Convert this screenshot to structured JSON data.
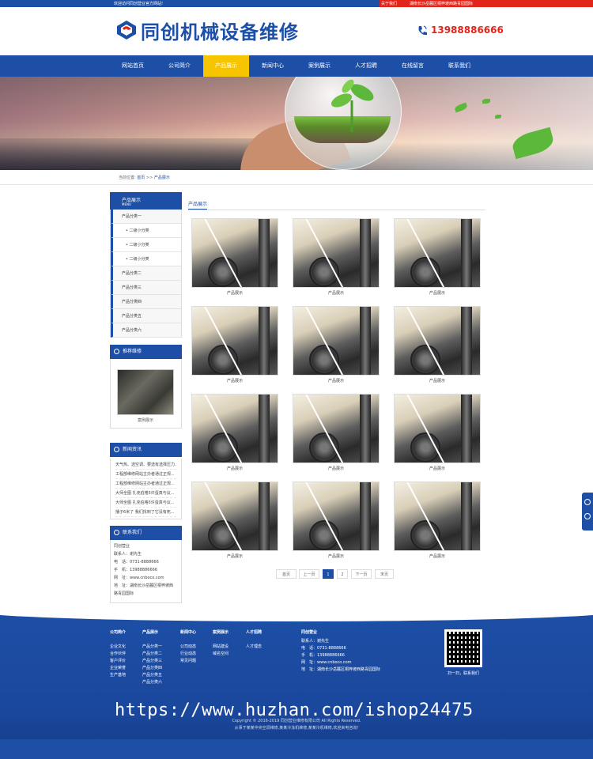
{
  "topbar": {
    "welcome": "欢迎访问同创营业官方网站!",
    "about": "关于我们",
    "address": "湖南长沙岳麓区桐梓坡西路青园国际"
  },
  "header": {
    "logo_text": "同创机械设备维修",
    "phone": "13988886666"
  },
  "nav": [
    "网站首页",
    "公司简介",
    "产品展示",
    "新闻中心",
    "案例展示",
    "人才招聘",
    "在线留言",
    "联系我们"
  ],
  "nav_active": "产品展示",
  "breadcrumb": {
    "label": "当前位置:",
    "home": "首页",
    "sep": " >> ",
    "current": "产品展示"
  },
  "sidebar": {
    "title": "产品展示",
    "subtitle": "MENU",
    "items": [
      {
        "label": "产品分类一",
        "sub": false
      },
      {
        "label": "• 二级小分类",
        "sub": true
      },
      {
        "label": "• 二级小分类",
        "sub": true
      },
      {
        "label": "• 二级小分类",
        "sub": true
      },
      {
        "label": "产品分类二",
        "sub": false
      },
      {
        "label": "产品分类三",
        "sub": false
      },
      {
        "label": "产品分类四",
        "sub": false
      },
      {
        "label": "产品分类五",
        "sub": false
      },
      {
        "label": "产品分类六",
        "sub": false
      }
    ],
    "recommend_title": "推荐维修",
    "recommend_caption": "案例展示",
    "news_title": "新闻资讯",
    "news": [
      "天气热、选空调、要选有选择压力...",
      "工程部维修网站主办者通过正规...",
      "工程部维修网站主办者通过正规...",
      "大师全图 扎克伯格5许蛋真与议...",
      "大师全图 扎克伯格5许蛋真与议...",
      "播子6米了 我们找到了它没有死..."
    ],
    "contact_title": "联系我们",
    "contact": [
      "同创营业",
      "联系人：谢先生",
      "电　话：0731-8888666",
      "手　机：13988886666",
      "网　址：www.cnboco.com",
      "地　址：湖南长沙岳麓区桐梓坡西",
      "路青园国际"
    ]
  },
  "main": {
    "title": "产品展示",
    "products": [
      "产品展示",
      "产品展示",
      "产品展示",
      "产品展示",
      "产品展示",
      "产品展示",
      "产品展示",
      "产品展示",
      "产品展示",
      "产品展示",
      "产品展示",
      "产品展示"
    ],
    "pager": {
      "first": "首页",
      "prev": "上一页",
      "p1": "1",
      "p2": "2",
      "next": "下一页",
      "last": "末页"
    }
  },
  "footer": {
    "cols": [
      {
        "h": "公司简介",
        "items": [
          "企业文化",
          "合作伙伴",
          "客户评价",
          "企业荣誉",
          "生产基地"
        ]
      },
      {
        "h": "产品展示",
        "items": [
          "产品分类一",
          "产品分类二",
          "产品分类三",
          "产品分类四",
          "产品分类五",
          "产品分类六"
        ]
      },
      {
        "h": "新闻中心",
        "items": [
          "公司动态",
          "行业动态",
          "常见问题"
        ]
      },
      {
        "h": "案例展示",
        "items": [
          "网站建设",
          "域名空间"
        ]
      },
      {
        "h": "人才招聘",
        "items": [
          "人才理念"
        ]
      }
    ],
    "company": "同创营业",
    "contact": [
      "联系人：谢先生",
      "电　话：0731-8888666",
      "手　机：13988886666",
      "网　址：www.cnboco.com",
      "地　址：湖南长沙岳麓区桐梓坡西路青园国际"
    ],
    "qr_caption": "扫一扫，联系我们",
    "copyright": "Copyright © 2016-2019 同创营业维修有限公司 All Rights Reserved.",
    "keywords": "从事于某某中央空调维修,某某冷冻机维修,某某冷机维修,欢迎来电咨询!",
    "watermark": "https://www.huzhan.com/ishop24475"
  }
}
